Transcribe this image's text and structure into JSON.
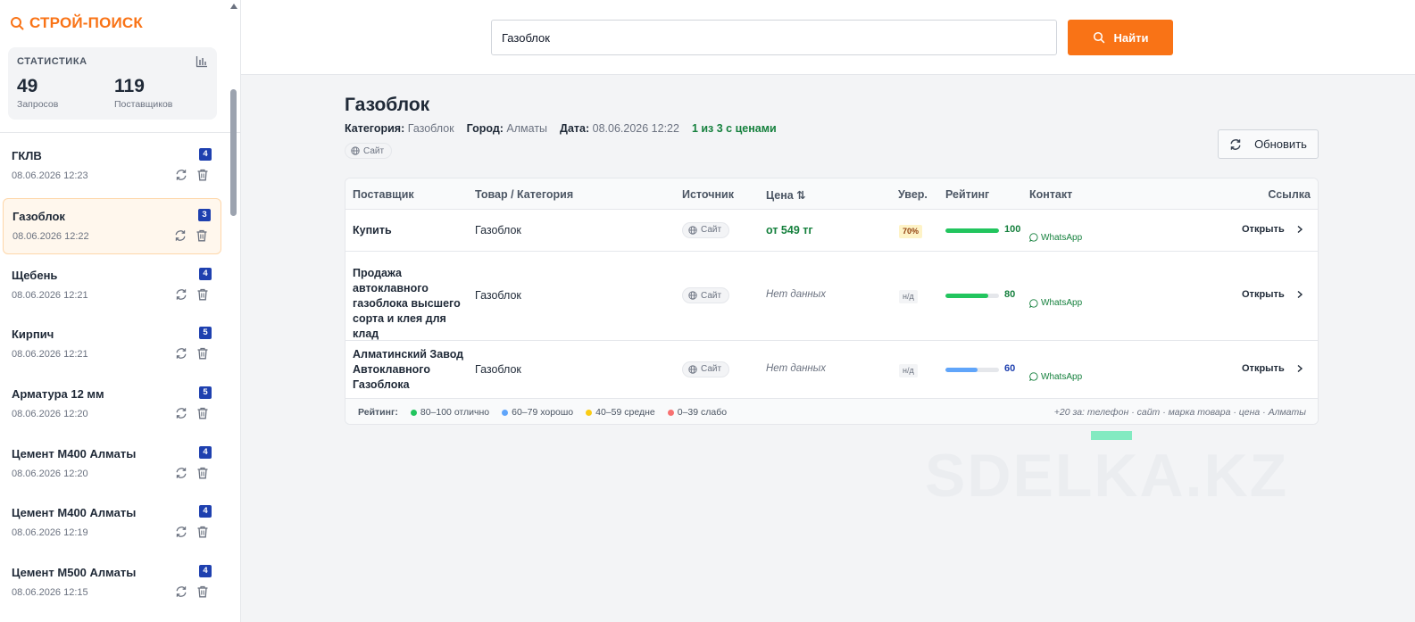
{
  "app": {
    "brand": "СТРОЙ-ПОИСК"
  },
  "stats": {
    "title": "СТАТИСТИКА",
    "queries_value": "49",
    "queries_label": "Запросов",
    "suppliers_value": "119",
    "suppliers_label": "Поставщиков"
  },
  "history": [
    {
      "name": "ГКЛВ",
      "date": "08.06.2026 12:23",
      "count": "4"
    },
    {
      "name": "Газоблок",
      "date": "08.06.2026 12:22",
      "count": "3"
    },
    {
      "name": "Щебень",
      "date": "08.06.2026 12:21",
      "count": "4"
    },
    {
      "name": "Кирпич",
      "date": "08.06.2026 12:21",
      "count": "5"
    },
    {
      "name": "Арматура 12 мм",
      "date": "08.06.2026 12:20",
      "count": "5"
    },
    {
      "name": "Цемент М400 Алматы",
      "date": "08.06.2026 12:20",
      "count": "4"
    },
    {
      "name": "Цемент М400 Алматы",
      "date": "08.06.2026 12:19",
      "count": "4"
    },
    {
      "name": "Цемент М500 Алматы",
      "date": "08.06.2026 12:15",
      "count": "4"
    }
  ],
  "search": {
    "value": "Газоблок",
    "button_label": "Найти"
  },
  "result": {
    "title": "Газоблок",
    "category_label": "Категория:",
    "category_value": "Газоблок",
    "city_label": "Город:",
    "city_value": "Алматы",
    "date_label": "Дата:",
    "date_value": "08.06.2026 12:22",
    "priced_summary": "1 из 3 с ценами",
    "source_tag": "Сайт",
    "refresh_label": "Обновить"
  },
  "table": {
    "columns": [
      "Поставщик",
      "Товар / Категория",
      "Источник",
      "Цена ⇅",
      "Увер.",
      "Рейтинг",
      "Контакт",
      "Ссылка"
    ],
    "rows": [
      {
        "supplier": "Купить",
        "product": "Газоблок",
        "source": "Сайт",
        "price": "от 549 тг",
        "confidence": "70%",
        "rating": "100",
        "rating_color": "#22c55e",
        "contact": "WhatsApp",
        "link": "Открыть"
      },
      {
        "supplier": "Продажа автоклавного газоблока высшего сорта и клея для клад",
        "product": "Газоблок",
        "source": "Сайт",
        "price": "Нет данных",
        "confidence": "н/д",
        "rating": "80",
        "rating_color": "#22c55e",
        "contact": "WhatsApp",
        "link": "Открыть"
      },
      {
        "supplier": "Алматинский Завод Автоклавного Газоблока",
        "product": "Газоблок",
        "source": "Сайт",
        "price": "Нет данных",
        "confidence": "н/д",
        "rating": "60",
        "rating_color": "#60a5fa",
        "contact": "WhatsApp",
        "link": "Открыть"
      }
    ],
    "legend_title": "Рейтинг:",
    "legend": [
      {
        "label": "80–100 отлично",
        "color": "#22c55e"
      },
      {
        "label": "60–79 хорошо",
        "color": "#60a5fa"
      },
      {
        "label": "40–59 средне",
        "color": "#facc15"
      },
      {
        "label": "0–39 слабо",
        "color": "#f87171"
      }
    ],
    "footnote": "+20 за: телефон · сайт · марка товара · цена · Алматы"
  },
  "watermark": "SDELKA.KZ",
  "colors": {
    "accent": "#f97316",
    "badge": "#1e40af",
    "positive": "#15803d"
  }
}
